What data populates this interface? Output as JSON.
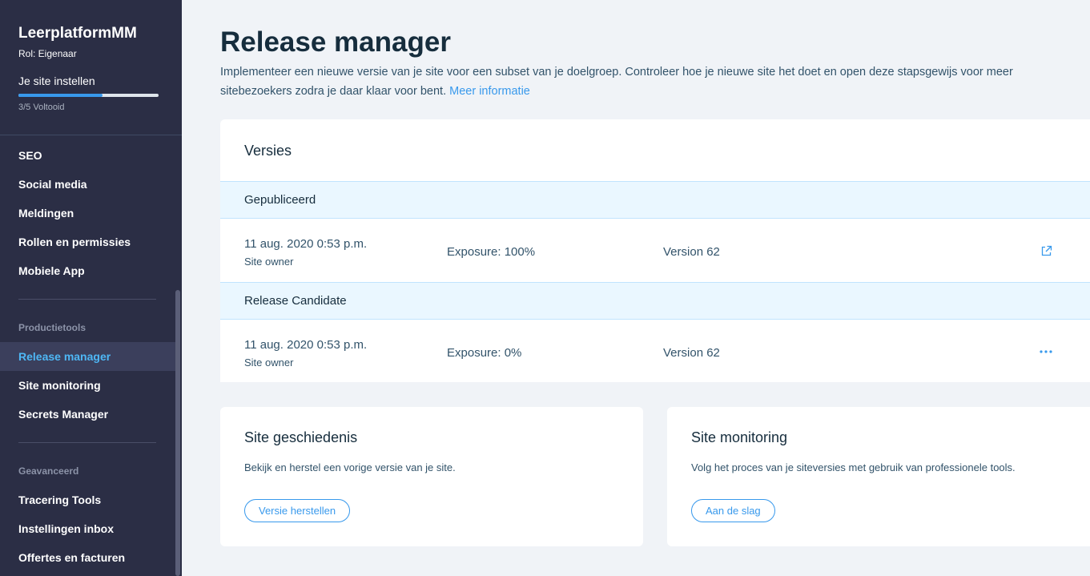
{
  "sidebar": {
    "site_name": "LeerplatformMM",
    "role": "Rol: Eigenaar",
    "setup_title": "Je site instellen",
    "setup_progress": 0.6,
    "setup_progress_text": "3/5 Voltooid",
    "items_top": [
      {
        "label": "SEO"
      },
      {
        "label": "Social media"
      },
      {
        "label": "Meldingen"
      },
      {
        "label": "Rollen en permissies"
      },
      {
        "label": "Mobiele App"
      }
    ],
    "section_production": "Productietools",
    "items_production": [
      {
        "label": "Release manager",
        "active": true
      },
      {
        "label": "Site monitoring"
      },
      {
        "label": "Secrets Manager"
      }
    ],
    "section_advanced": "Geavanceerd",
    "items_advanced": [
      {
        "label": "Tracering Tools"
      },
      {
        "label": "Instellingen inbox"
      },
      {
        "label": "Offertes en facturen"
      }
    ]
  },
  "main": {
    "title": "Release manager",
    "description": "Implementeer een nieuwe versie van je site voor een subset van je doelgroep. Controleer hoe je nieuwe site het doet en open deze stapsgewijs voor meer sitebezoekers zodra je daar klaar voor bent.",
    "more_info_link": "Meer informatie",
    "versions": {
      "title": "Versies",
      "published": {
        "label": "Gepubliceerd",
        "date": "11 aug. 2020 0:53 p.m.",
        "owner": "Site owner",
        "exposure": "Exposure: 100%",
        "version": "Version 62",
        "action_icon": "external-link-icon"
      },
      "candidate": {
        "label": "Release Candidate",
        "date": "11 aug. 2020 0:53 p.m.",
        "owner": "Site owner",
        "exposure": "Exposure: 0%",
        "version": "Version 62",
        "action_icon": "more-options-icon"
      }
    },
    "history_card": {
      "title": "Site geschiedenis",
      "description": "Bekijk en herstel een vorige versie van je site.",
      "button": "Versie herstellen"
    },
    "monitoring_card": {
      "title": "Site monitoring",
      "description": "Volg het proces van je siteversies met gebruik van professionele tools.",
      "button": "Aan de slag"
    }
  },
  "colors": {
    "sidebar_bg": "#2b2e45",
    "accent": "#3899ec",
    "active_text": "#4eb7f5",
    "page_bg": "#f0f3f7"
  }
}
